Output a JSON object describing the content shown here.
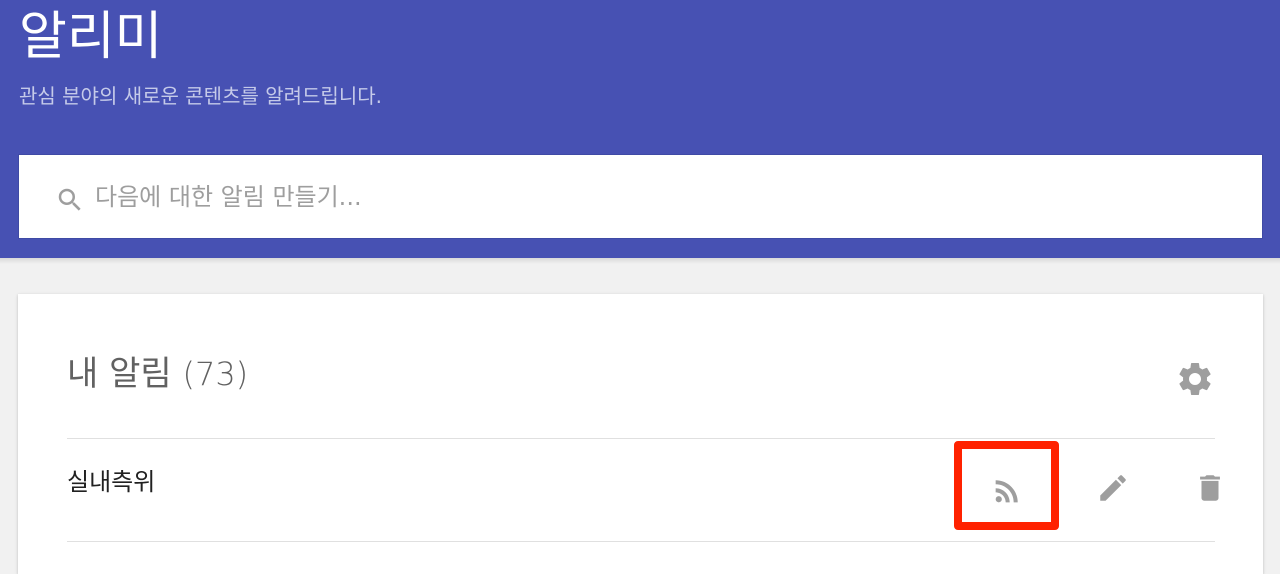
{
  "header": {
    "title": "알리미",
    "subtitle": "관심 분야의 새로운 콘텐츠를 알려드립니다.",
    "background_color": "#4751b3"
  },
  "search": {
    "placeholder": "다음에 대한 알림 만들기...",
    "value": "",
    "icon": "search-icon"
  },
  "my_alerts": {
    "title": "내 알림",
    "count": "(73)",
    "settings_icon": "gear-icon",
    "items": [
      {
        "name": "실내측위",
        "actions": [
          "rss-icon",
          "pencil-icon",
          "trash-icon"
        ],
        "highlighted_action": "rss-icon",
        "highlight_color": "#ff2200"
      }
    ]
  }
}
